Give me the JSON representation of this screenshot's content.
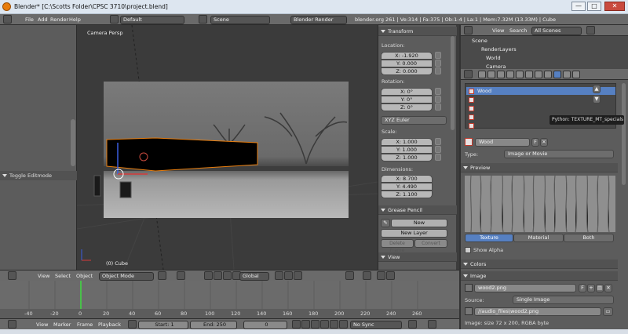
{
  "window": {
    "title": "Blender* [C:\\Scotts Folder\\CPSC 3710\\project.blend]",
    "minimize": "—",
    "maximize": "□",
    "close": "✕"
  },
  "infobar": {
    "menus": [
      "File",
      "Add",
      "Render",
      "Help"
    ],
    "layout": "Default",
    "scene": "Scene",
    "engine": "Blender Render",
    "stats": "blender.org 261 | Ve:314 | Fa:375 | Ob:1-4 | La:1 | Mem:7.32M (13.33M) | Cube"
  },
  "toolshelf": {
    "toggle_editmode": "Toggle Editmode"
  },
  "viewport": {
    "camera_label": "Camera Persp",
    "object_label": "(0) Cube"
  },
  "npanel": {
    "transform_title": "Transform",
    "location_label": "Location:",
    "location": [
      "X: -1.920",
      "Y: 0.000",
      "Z: 0.000"
    ],
    "rotation_label": "Rotation:",
    "rotation": [
      "X: 0°",
      "Y: 0°",
      "Z: 0°"
    ],
    "rotation_mode": "XYZ Euler",
    "scale_label": "Scale:",
    "scale": [
      "X: 1.000",
      "Y: 1.000",
      "Z: 1.000"
    ],
    "dimensions_label": "Dimensions:",
    "dimensions": [
      "X: 8.700",
      "Y: 4.490",
      "Z: 1.100"
    ],
    "grease_title": "Grease Pencil",
    "new_btn": "New",
    "new_layer_btn": "New Layer",
    "delete_frame_btn": "Delete Frame",
    "convert_btn": "Convert",
    "view_title": "View"
  },
  "outliner": {
    "view": "View",
    "search": "Search",
    "filter": "All Scenes",
    "rows": [
      "Scene",
      "RenderLayers",
      "World",
      "Camera"
    ]
  },
  "properties": {
    "slots": [
      "Wood",
      "",
      "",
      "",
      ""
    ],
    "tooltip": "Python: TEXTURE_MT_specials",
    "texture_name": "Wood",
    "users": "F",
    "type_label": "Type:",
    "type_value": "Image or Movie",
    "preview_title": "Preview",
    "tabs": [
      "Texture",
      "Material",
      "Both"
    ],
    "show_alpha": "Show Alpha",
    "colors_title": "Colors",
    "image_title": "Image",
    "image_name": "wood2.png",
    "source_label": "Source:",
    "source_value": "Single Image",
    "filepath": "//audio_files\\wood2.png",
    "image_info": "Image: size 72 x 200, RGBA byte"
  },
  "view3d_header": {
    "items": [
      "View",
      "Select",
      "Object"
    ],
    "mode": "Object Mode",
    "orientation": "Global"
  },
  "timeline": {
    "ticks": [
      "-40",
      "-20",
      "0",
      "20",
      "40",
      "60",
      "80",
      "100",
      "120",
      "140",
      "160",
      "180",
      "200",
      "220",
      "240",
      "260"
    ],
    "current_frame_marker": "0"
  },
  "timeline_header": {
    "items": [
      "View",
      "Marker",
      "Frame",
      "Playback"
    ],
    "start": "Start: 1",
    "end": "End: 250",
    "current": "0",
    "sync": "No Sync"
  },
  "colors": {
    "selection": "#5680c2",
    "accent_orange": "#e87d0d",
    "header": "#6a6a6a",
    "panel": "#5c5c5c"
  }
}
